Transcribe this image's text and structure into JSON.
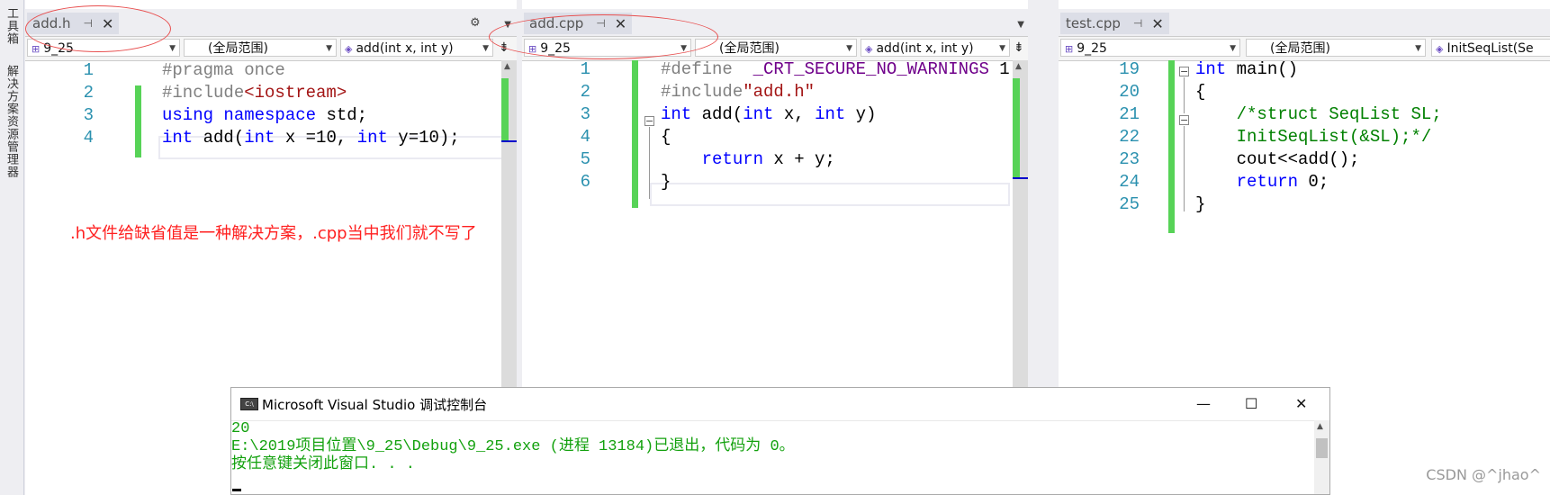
{
  "sidebar": {
    "toolbox": "工具箱",
    "solution_explorer": "解决方案资源管理器"
  },
  "pane1": {
    "tab": "add.h",
    "project": "9_25",
    "scope": "(全局范围)",
    "member": "add(int x, int y)",
    "lines": [
      {
        "n": "1",
        "parts": [
          [
            "pp",
            "#pragma once"
          ]
        ]
      },
      {
        "n": "2",
        "parts": [
          [
            "pp",
            "#include"
          ],
          [
            "str",
            "<iostream>"
          ]
        ]
      },
      {
        "n": "3",
        "parts": [
          [
            "kw",
            "using"
          ],
          [
            "",
            " "
          ],
          [
            "kw",
            "namespace"
          ],
          [
            "",
            " std;"
          ]
        ]
      },
      {
        "n": "4",
        "parts": [
          [
            "kw",
            "int"
          ],
          [
            "",
            " add("
          ],
          [
            "kw",
            "int"
          ],
          [
            "",
            " x =10, "
          ],
          [
            "kw",
            "int"
          ],
          [
            "",
            " y=10);"
          ]
        ]
      }
    ]
  },
  "pane2": {
    "tab": "add.cpp",
    "project": "9_25",
    "scope": "(全局范围)",
    "member": "add(int x, int y)",
    "lines": [
      {
        "n": "1",
        "parts": [
          [
            "pp",
            "#define  "
          ],
          [
            "mac",
            "_CRT_SECURE_NO_WARNINGS"
          ],
          [
            "",
            " 1"
          ]
        ]
      },
      {
        "n": "2",
        "parts": [
          [
            "pp",
            "#include"
          ],
          [
            "str",
            "\"add.h\""
          ]
        ]
      },
      {
        "n": "3",
        "parts": [
          [
            "kw",
            "int"
          ],
          [
            "",
            " add("
          ],
          [
            "kw",
            "int"
          ],
          [
            "",
            " x, "
          ],
          [
            "kw",
            "int"
          ],
          [
            "",
            " y)"
          ]
        ]
      },
      {
        "n": "4",
        "parts": [
          [
            "",
            "{"
          ]
        ]
      },
      {
        "n": "5",
        "parts": [
          [
            "",
            "    "
          ],
          [
            "kw",
            "return"
          ],
          [
            "",
            " x + y;"
          ]
        ]
      },
      {
        "n": "6",
        "parts": [
          [
            "",
            "}"
          ]
        ]
      }
    ]
  },
  "pane3": {
    "tab": "test.cpp",
    "project": "9_25",
    "scope": "(全局范围)",
    "member": "InitSeqList(Se",
    "lines": [
      {
        "n": "19",
        "parts": [
          [
            "kw",
            "int"
          ],
          [
            "",
            " main()"
          ]
        ]
      },
      {
        "n": "20",
        "parts": [
          [
            "",
            "{"
          ]
        ]
      },
      {
        "n": "21",
        "parts": [
          [
            "",
            "    "
          ],
          [
            "cm",
            "/*struct SeqList SL;"
          ]
        ]
      },
      {
        "n": "22",
        "parts": [
          [
            "",
            "    "
          ],
          [
            "cm",
            "InitSeqList(&SL);*/"
          ]
        ]
      },
      {
        "n": "23",
        "parts": [
          [
            "",
            "    cout<<add();"
          ]
        ]
      },
      {
        "n": "24",
        "parts": [
          [
            "",
            "    "
          ],
          [
            "kw",
            "return"
          ],
          [
            "",
            " 0;"
          ]
        ]
      },
      {
        "n": "25",
        "parts": [
          [
            "",
            "}"
          ]
        ]
      }
    ]
  },
  "annotation": ".h文件给缺省值是一种解决方案，.cpp当中我们就不写了",
  "console": {
    "title": "Microsoft Visual Studio 调试控制台",
    "line1": "20",
    "line2": "E:\\2019项目位置\\9_25\\Debug\\9_25.exe (进程 13184)已退出，代码为 0。",
    "line3": "按任意键关闭此窗口. . ."
  },
  "watermark": "CSDN @^jhao^",
  "icons": {
    "pin": "pin-icon",
    "close": "close-icon",
    "gear": "gear-icon"
  }
}
